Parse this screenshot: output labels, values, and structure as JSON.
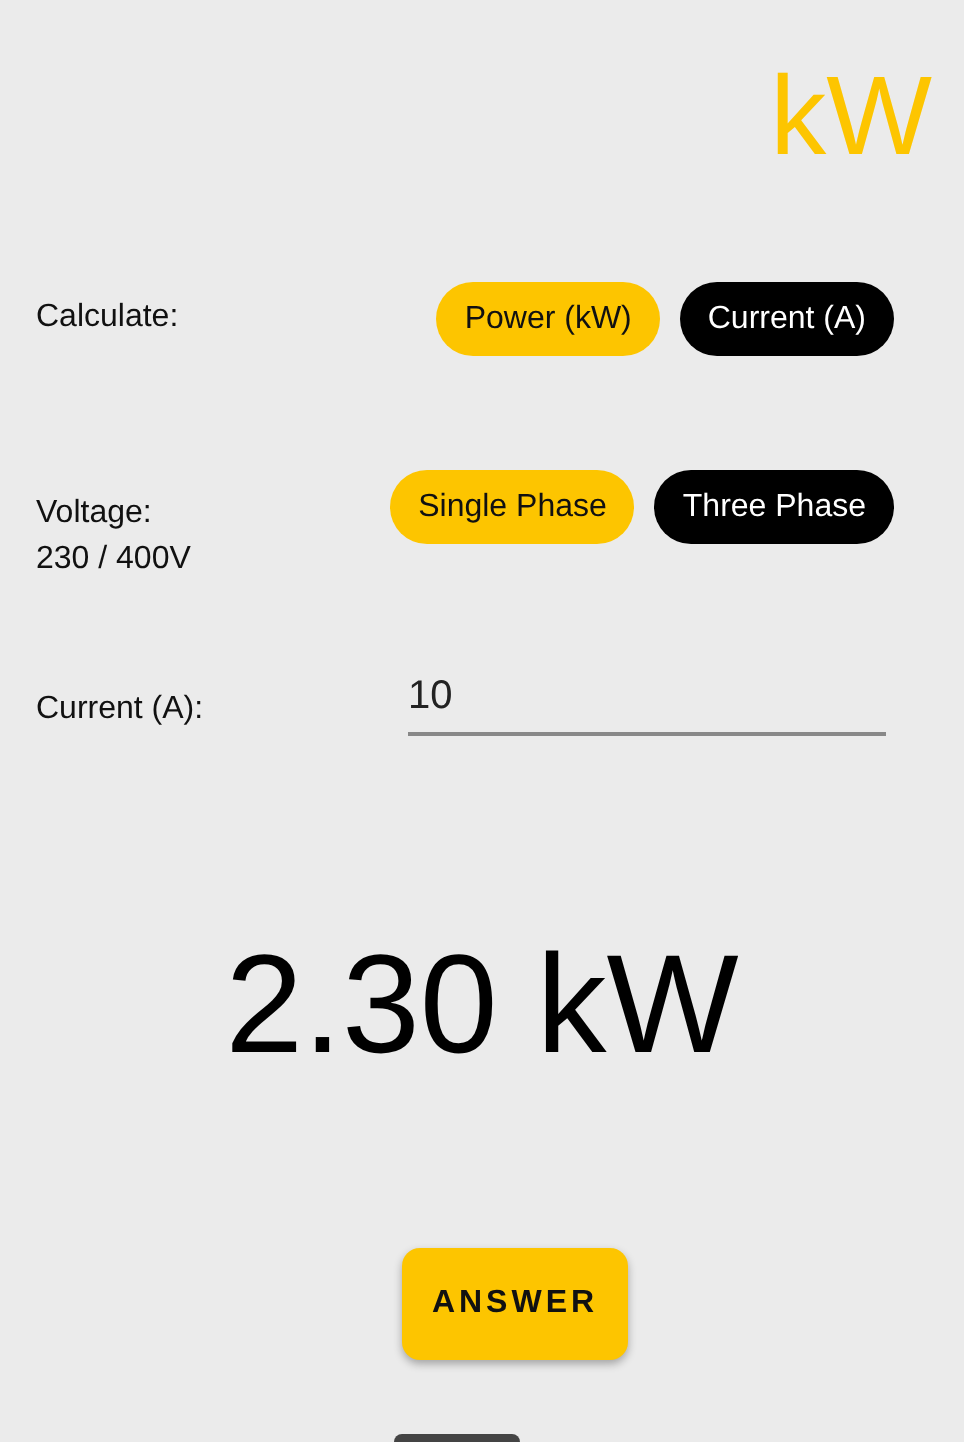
{
  "header": {
    "title": "kW"
  },
  "calculate": {
    "label": "Calculate:",
    "options": [
      {
        "label": "Power (kW)",
        "selected": true
      },
      {
        "label": "Current (A)",
        "selected": false
      }
    ]
  },
  "voltage": {
    "label": "Voltage:",
    "sublabel": "230 / 400V",
    "options": [
      {
        "label": "Single Phase",
        "selected": true
      },
      {
        "label": "Three Phase",
        "selected": false
      }
    ]
  },
  "current": {
    "label": "Current (A):",
    "value": "10"
  },
  "result": "2.30 kW",
  "answer_button": "ANSWER"
}
